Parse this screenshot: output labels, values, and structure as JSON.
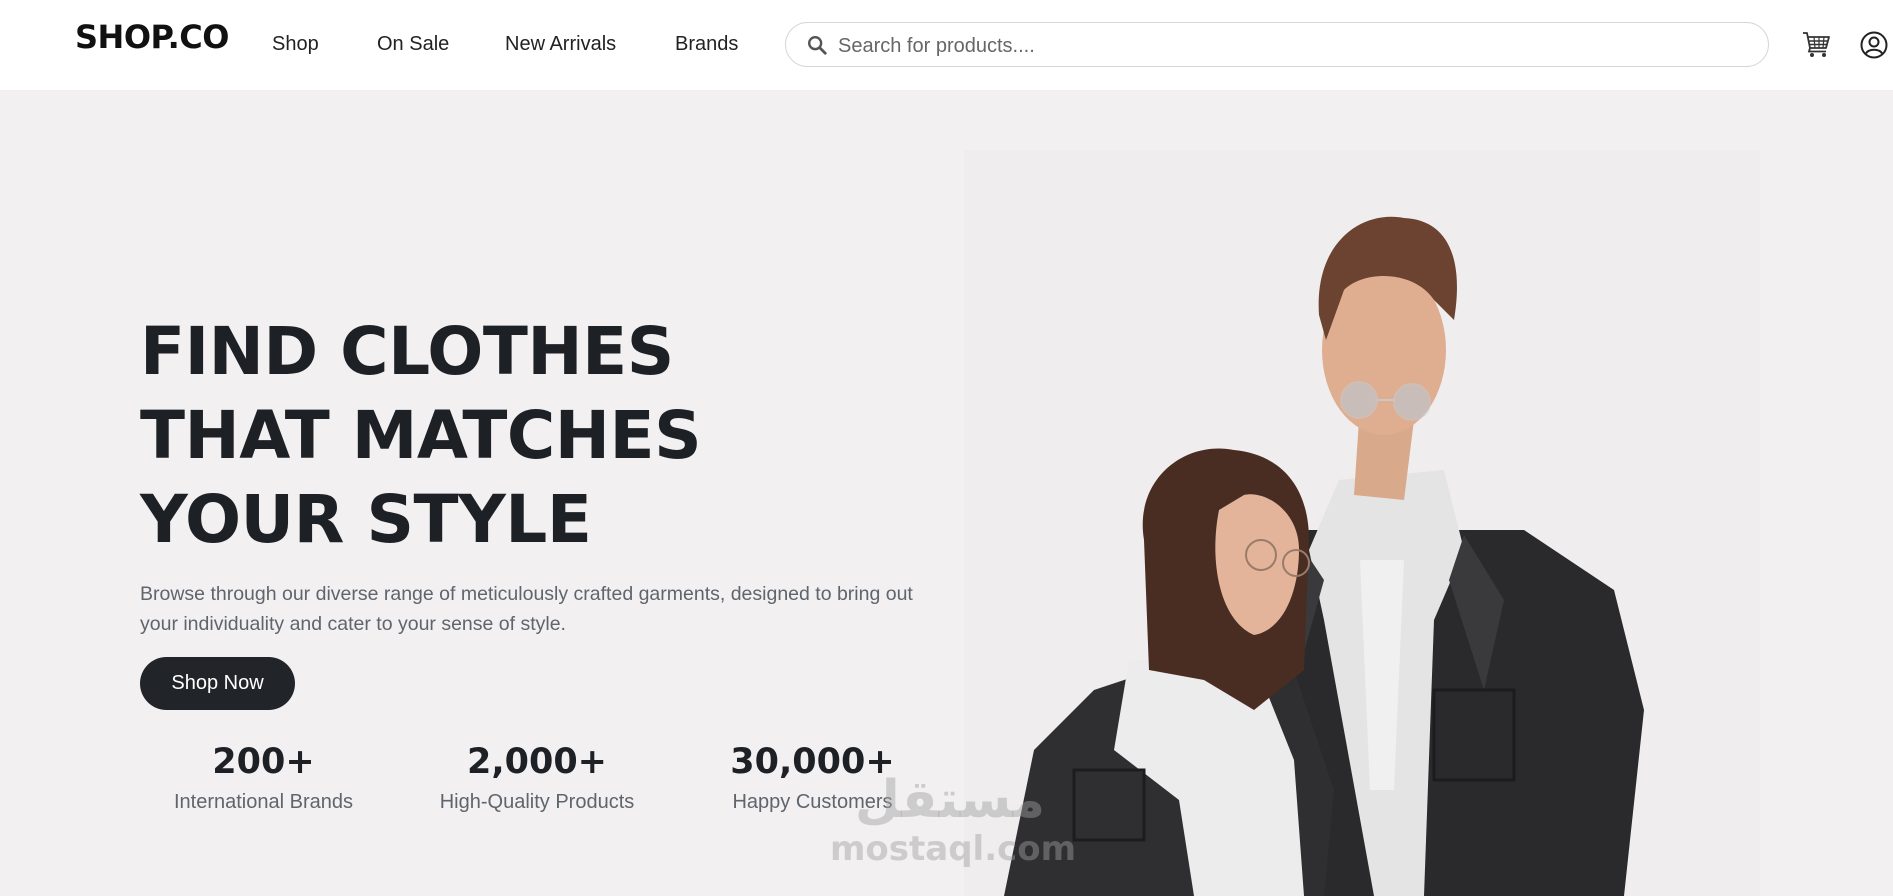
{
  "header": {
    "logo": "SHOP.CO",
    "nav": [
      {
        "label": "Shop"
      },
      {
        "label": "On Sale"
      },
      {
        "label": "New Arrivals"
      },
      {
        "label": "Brands"
      }
    ],
    "search": {
      "placeholder": "Search for products....",
      "value": ""
    },
    "icons": [
      "search-icon",
      "cart-icon",
      "account-icon"
    ]
  },
  "hero": {
    "title_lines": [
      "FIND CLOTHES",
      "THAT MATCHES",
      "YOUR STYLE"
    ],
    "description": "Browse through our diverse range of meticulously crafted garments, designed to bring out your individuality and cater to your sense of style.",
    "cta_label": "Shop Now",
    "stats": [
      {
        "value": "200+",
        "label": "International Brands"
      },
      {
        "value": "2,000+",
        "label": "High-Quality Products"
      },
      {
        "value": "30,000+",
        "label": "Happy Customers"
      }
    ]
  },
  "watermark": {
    "arabic": "مستقل",
    "latin": "mostaql.com"
  },
  "colors": {
    "page_background": "#f2f0f1",
    "header_background": "#ffffff",
    "button_background": "#212529",
    "text_dark": "#1d2126",
    "text_muted": "#5f656c"
  }
}
